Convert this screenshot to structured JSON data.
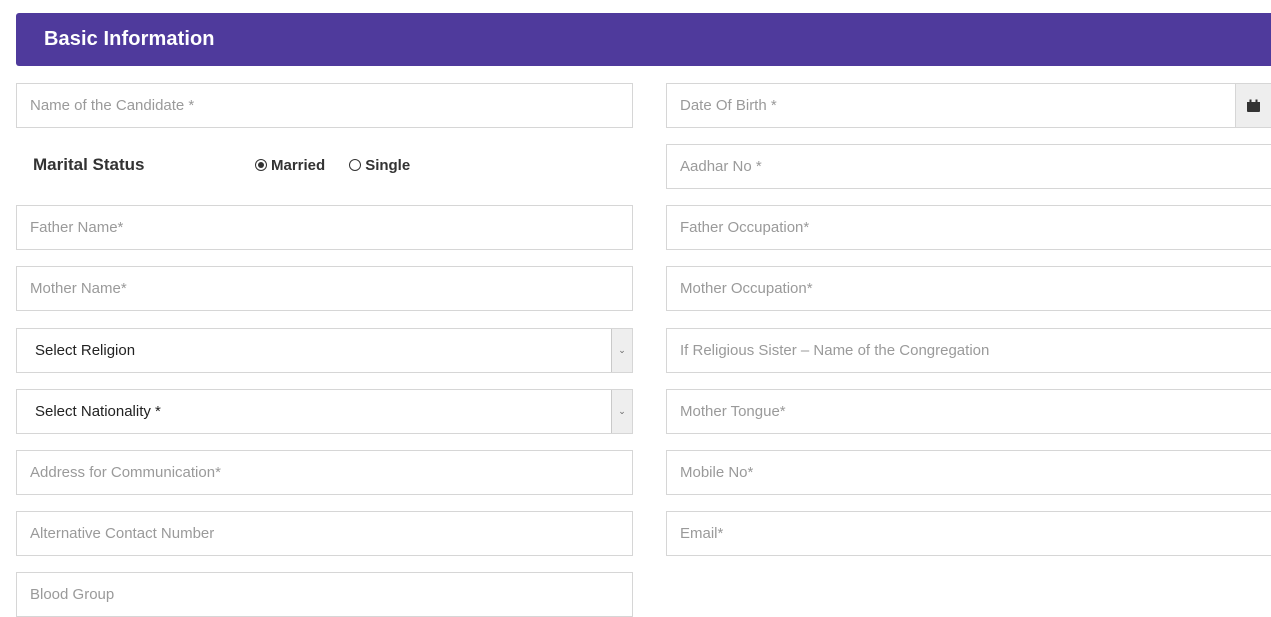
{
  "header": {
    "title": "Basic Information"
  },
  "left_fields": {
    "name_placeholder": "Name of the Candidate *",
    "father_name_placeholder": "Father Name*",
    "mother_name_placeholder": "Mother Name*",
    "religion_select": "Select Religion",
    "nationality_select": "Select Nationality *",
    "address_placeholder": "Address for Communication*",
    "alt_contact_placeholder": "Alternative Contact Number",
    "blood_group_placeholder": "Blood Group"
  },
  "marital": {
    "label": "Marital Status",
    "options": [
      "Married",
      "Single"
    ],
    "selected": "Married"
  },
  "right_fields": {
    "dob_placeholder": "Date Of Birth *",
    "aadhar_placeholder": "Aadhar No *",
    "father_occupation_placeholder": "Father Occupation*",
    "mother_occupation_placeholder": "Mother Occupation*",
    "congregation_placeholder": "If Religious Sister – Name of the Congregation",
    "mother_tongue_placeholder": "Mother Tongue*",
    "mobile_placeholder": "Mobile No*",
    "email_placeholder": "Email*"
  },
  "icons": {
    "calendar": "calendar-icon",
    "dropdown": "chevron-down-icon"
  },
  "colors": {
    "header_bg": "#4f3a9c",
    "border": "#d6d6d6",
    "placeholder": "#9a9a9a"
  }
}
